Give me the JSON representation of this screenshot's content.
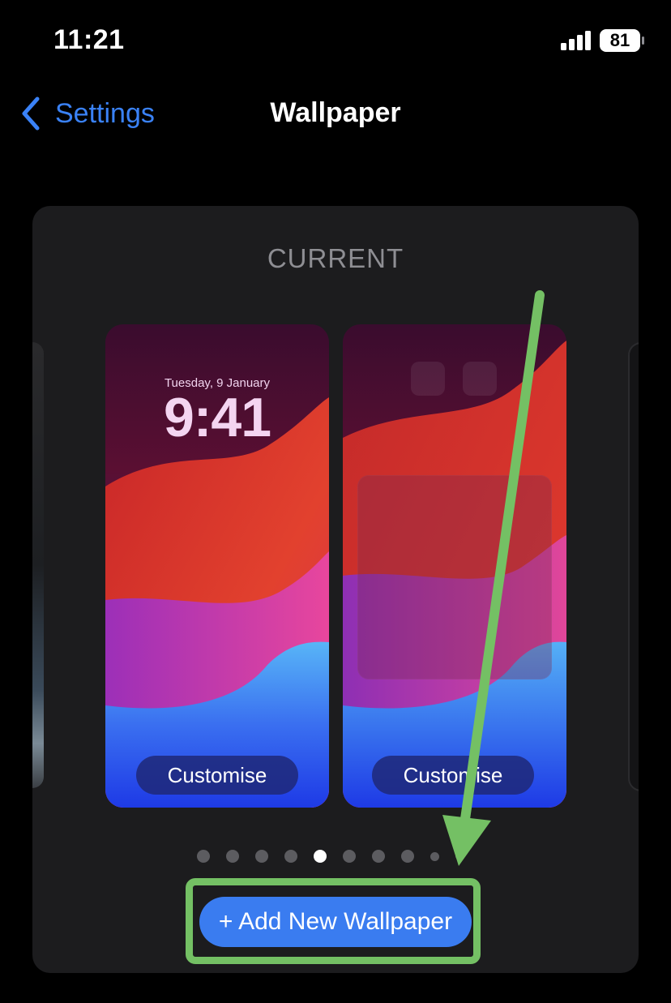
{
  "status_bar": {
    "time": "11:21",
    "battery": "81",
    "signal_icon": "cellular-signal-icon",
    "battery_icon": "battery-icon"
  },
  "nav": {
    "back_label": "Settings",
    "back_icon": "chevron-left-icon",
    "title": "Wallpaper"
  },
  "wallpaper": {
    "section_label": "CURRENT",
    "lock_screen": {
      "date": "Tuesday, 9 January",
      "time": "9:41",
      "button": "Customise"
    },
    "home_screen": {
      "button": "Customise"
    },
    "page_count": 10,
    "active_page": 5,
    "add_button": "+ Add New Wallpaper"
  },
  "annotation": {
    "color": "#74c064",
    "type": "arrow-and-highlight"
  },
  "colors": {
    "accent": "#3a82f7",
    "button": "#3a7cf0",
    "card": "#1c1c1e",
    "background": "#000000"
  }
}
